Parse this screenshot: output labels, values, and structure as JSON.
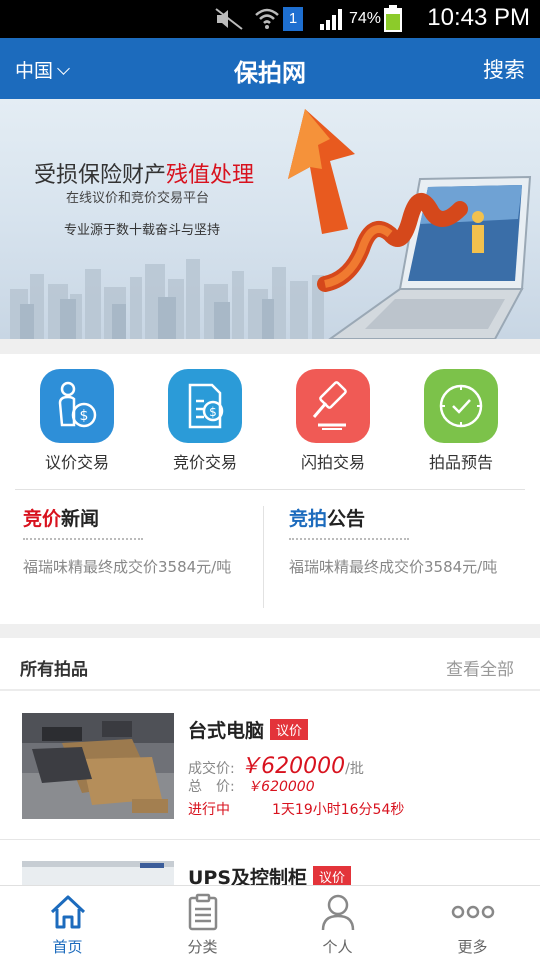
{
  "status_bar": {
    "battery": "74%",
    "time": "10:43 PM",
    "sim_badge": "1"
  },
  "header": {
    "region": "中国",
    "title": "保拍网",
    "search": "搜索"
  },
  "banner": {
    "headline_prefix": "受损保险财产",
    "headline_highlight": "残值处理",
    "subtitle": "在线议价和竞价交易平台",
    "tagline": "专业源于数十载奋斗与坚持"
  },
  "quick_entries": [
    {
      "label": "议价交易",
      "icon": "person-coin-icon",
      "color": "#2e8fd8"
    },
    {
      "label": "竞价交易",
      "icon": "document-coin-icon",
      "color": "#2b9bd8"
    },
    {
      "label": "闪拍交易",
      "icon": "gavel-icon",
      "color": "#f05a55"
    },
    {
      "label": "拍品预告",
      "icon": "clock-icon",
      "color": "#7cc24a"
    }
  ],
  "news": {
    "left": {
      "title_highlight": "竞价",
      "title_rest": "新闻",
      "body": "福瑞味精最终成交价3584元/吨"
    },
    "right": {
      "title_highlight": "竞拍",
      "title_rest": "公告",
      "body": "福瑞味精最终成交价3584元/吨"
    }
  },
  "all_items": {
    "title": "所有拍品",
    "view_all": "查看全部",
    "items": [
      {
        "name": "台式电脑",
        "tag": "议价",
        "deal_label": "成交价:",
        "deal_price": "￥620000",
        "deal_unit": "/批",
        "total_label": "总　价:",
        "total_price": "￥620000",
        "status": "进行中",
        "countdown": "1天19小时16分54秒"
      },
      {
        "name": "UPS及控制柜",
        "tag": "议价"
      }
    ]
  },
  "tabbar": {
    "tabs": [
      {
        "label": "首页",
        "icon": "home-icon",
        "active": true
      },
      {
        "label": "分类",
        "icon": "clipboard-icon",
        "active": false
      },
      {
        "label": "个人",
        "icon": "person-icon",
        "active": false
      },
      {
        "label": "更多",
        "icon": "more-dots-icon",
        "active": false
      }
    ]
  },
  "colors": {
    "primary": "#1c6bbd",
    "accent_red": "#d8121e",
    "tag_red": "#e3343a"
  }
}
